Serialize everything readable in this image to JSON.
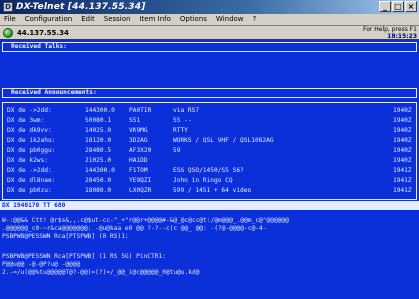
{
  "window": {
    "title": "DX-Telnet [44.137.55.34]",
    "icon_text": "D",
    "buttons": {
      "minimize": "_",
      "maximize": "□",
      "close": "×"
    }
  },
  "menu": {
    "items": [
      "File",
      "Configuration",
      "Edit",
      "Session",
      "Item Info",
      "Options",
      "Window",
      "?"
    ],
    "restore": "_ □ ×"
  },
  "status": {
    "ip": "44.137.55.34",
    "help": "For Help, press F1",
    "time": "18:15:23"
  },
  "terminal": {
    "headers": {
      "talks": "Received Talks:",
      "announcements": "Received Announcements:"
    },
    "spots": [
      {
        "tag": "DX de ->2dd:",
        "freq": "144300.0",
        "call": "PA0TIR",
        "comment": "via RS7",
        "time": "1940Z"
      },
      {
        "tag": "DX de 3wm:",
        "freq": "50080.1",
        "call": "S51",
        "comment": "55 --",
        "time": "1940Z"
      },
      {
        "tag": "DX de dk9vv:",
        "freq": "14025.0",
        "call": "VK9MG",
        "comment": "RTTY",
        "time": "1940Z"
      },
      {
        "tag": "DX de ik2ahu:",
        "freq": "18120.0",
        "call": "3D2AG",
        "comment": "WORKS / QSL VHF / QSL1082AG",
        "time": "1940Z"
      },
      {
        "tag": "DX de pb0ggu:",
        "freq": "28480.5",
        "call": "AF3X20",
        "comment": "59",
        "time": "1940Z"
      },
      {
        "tag": "DX de k2ws:",
        "freq": "21025.0",
        "call": "HA1DD",
        "comment": "",
        "time": "1940Z"
      },
      {
        "tag": "DX de ->2dd:",
        "freq": "144300.0",
        "call": "F1TOM",
        "comment": "ESG QSO/1450/S5 S6?",
        "time": "1941Z"
      },
      {
        "tag": "DX de dl8nae:",
        "freq": "28450.0",
        "call": "YE9QZI",
        "comment": "John in Ringo CQ",
        "time": "1941Z"
      },
      {
        "tag": "DX de pb0zu:",
        "freq": "18080.0",
        "call": "LX0QZR",
        "comment": "599 / 1451 + 64 video",
        "time": "1941Z"
      }
    ],
    "inverse_line": "DX 1940170 TT 680",
    "lines": [
      "W-:@@&&  Ctt!  @r$s&,,.c@$ut-cc-\"_+\"r@@r+@@@@#-&@_@c@cc@t:/@m@@@_.@@m_c@\"@@@@@@",
      ".@@@@@@_c0-~r&ca@@@@@@@:   -@u@kaa e0 @@  ?-?--c(c @@_  @@:  -(?@-@@@@-c@-4-",
      "PSBPWB@PESSWN Rca[PTSPWB] (0 RS)1:",
      "",
      "PSBPWB@PESSWN Rca[PTSPWB] (1 RS 5G) PinCTR1:",
      "P@@u@@ -@-@P?u@ -@@@@",
      "2.-=/u(@@%tu@@@@@T@?-@@)=(?)=/_@@_i@c@@@@@_0@tu@u.kd@"
    ]
  }
}
